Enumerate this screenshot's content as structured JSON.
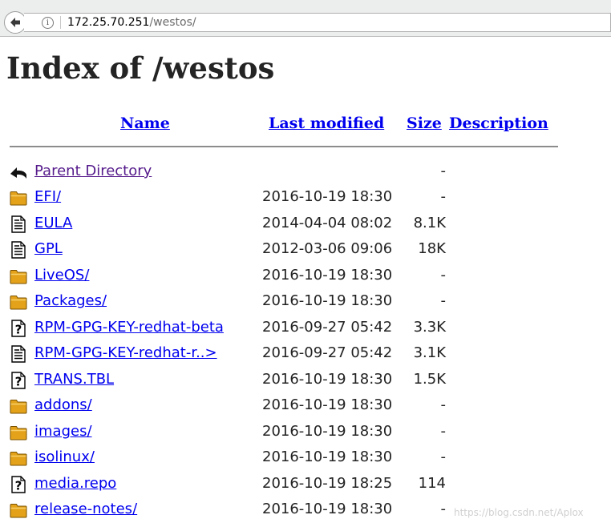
{
  "browser": {
    "url_host": "172.25.70.251",
    "url_path": "/westos/"
  },
  "page": {
    "title": "Index of /westos"
  },
  "columns": {
    "name": "Name",
    "last_modified": "Last modified",
    "size": "Size",
    "description": "Description"
  },
  "rows": [
    {
      "icon": "back-icon",
      "name": "Parent Directory",
      "modified": "",
      "size": "-",
      "visited": true
    },
    {
      "icon": "folder-icon",
      "name": "EFI/",
      "modified": "2016-10-19 18:30",
      "size": "-"
    },
    {
      "icon": "text-file-icon",
      "name": "EULA",
      "modified": "2014-04-04 08:02",
      "size": "8.1K"
    },
    {
      "icon": "text-file-icon",
      "name": "GPL",
      "modified": "2012-03-06 09:06",
      "size": "18K"
    },
    {
      "icon": "folder-icon",
      "name": "LiveOS/",
      "modified": "2016-10-19 18:30",
      "size": "-"
    },
    {
      "icon": "folder-icon",
      "name": "Packages/",
      "modified": "2016-10-19 18:30",
      "size": "-"
    },
    {
      "icon": "unknown-file-icon",
      "name": "RPM-GPG-KEY-redhat-beta",
      "modified": "2016-09-27 05:42",
      "size": "3.3K"
    },
    {
      "icon": "text-file-icon",
      "name": "RPM-GPG-KEY-redhat-r..>",
      "modified": "2016-09-27 05:42",
      "size": "3.1K"
    },
    {
      "icon": "unknown-file-icon",
      "name": "TRANS.TBL",
      "modified": "2016-10-19 18:30",
      "size": "1.5K"
    },
    {
      "icon": "folder-icon",
      "name": "addons/",
      "modified": "2016-10-19 18:30",
      "size": "-"
    },
    {
      "icon": "folder-icon",
      "name": "images/",
      "modified": "2016-10-19 18:30",
      "size": "-"
    },
    {
      "icon": "folder-icon",
      "name": "isolinux/",
      "modified": "2016-10-19 18:30",
      "size": "-"
    },
    {
      "icon": "unknown-file-icon",
      "name": "media.repo",
      "modified": "2016-10-19 18:25",
      "size": "114"
    },
    {
      "icon": "folder-icon",
      "name": "release-notes/",
      "modified": "2016-10-19 18:30",
      "size": "-"
    }
  ],
  "watermark": "https://blog.csdn.net/Aplox"
}
